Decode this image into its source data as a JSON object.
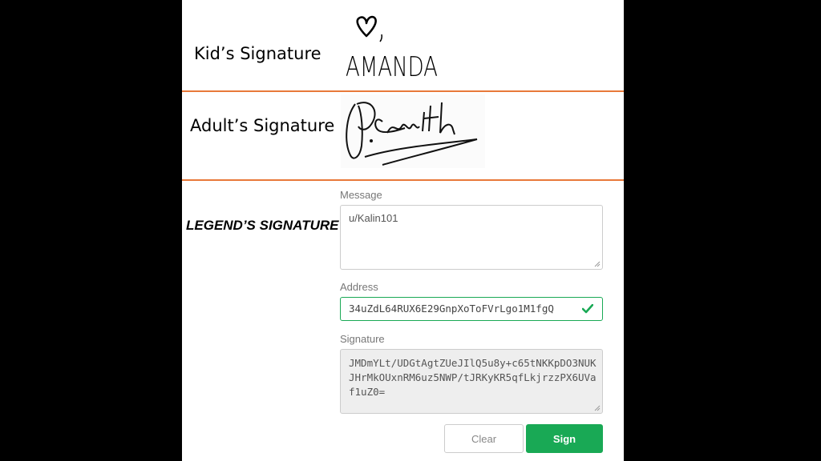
{
  "signatures": {
    "kid_label": "Kid’s Signature",
    "kid_signature_text": "AMANDA",
    "adult_label": "Adult’s Signature",
    "legend_label": "LEGEND’S SIGNATURE"
  },
  "form": {
    "message_label": "Message",
    "message_value": "u/Kalin101",
    "address_label": "Address",
    "address_value": "34uZdL64RUX6E29GnpXoToFVrLgo1M1fgQ",
    "signature_label": "Signature",
    "signature_lines": [
      "JMDmYLt/UDGtAgtZUeJIlQ5u8y+c65tNKKpDO3NUK",
      "JHrMkOUxnRM6uz5NWP/tJRKyKR5qfLkjrzzPX6UVa",
      "f1uZ0="
    ],
    "clear_label": "Clear",
    "sign_label": "Sign"
  },
  "colors": {
    "divider": "#e8793a",
    "sign_button": "#19a955",
    "valid_check": "#19a955"
  },
  "icons": {
    "address_status": "check-icon",
    "kid_doodle": "heart-icon"
  }
}
